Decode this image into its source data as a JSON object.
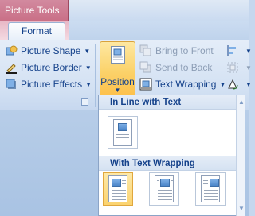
{
  "window": {
    "context_tab_title": "Picture Tools"
  },
  "ribbon": {
    "active_tab": "Format",
    "picture_styles": [
      {
        "label": "Picture Shape",
        "icon": "picture-shape-icon"
      },
      {
        "label": "Picture Border",
        "icon": "picture-border-icon"
      },
      {
        "label": "Picture Effects",
        "icon": "picture-effects-icon"
      }
    ],
    "arrange": {
      "position_label": "Position",
      "bring_to_front": "Bring to Front",
      "send_to_back": "Send to Back",
      "text_wrapping": "Text Wrapping"
    }
  },
  "position_menu": {
    "section_inline": "In Line with Text",
    "section_wrapping": "With Text Wrapping"
  },
  "colors": {
    "context_tab": "#c96f86",
    "ribbon_text": "#15428b",
    "selected_item": "#fbd36f"
  }
}
